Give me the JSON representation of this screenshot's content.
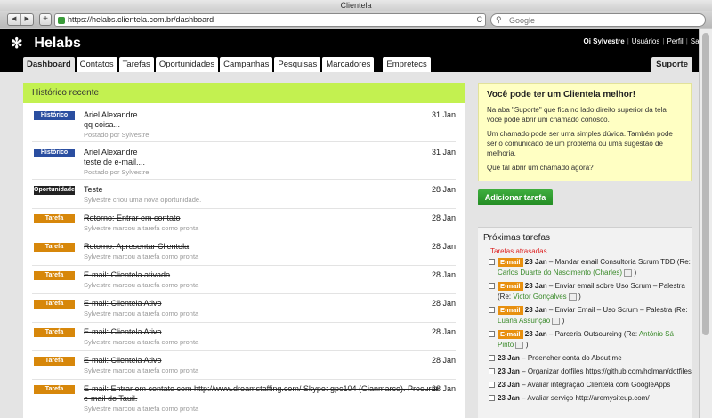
{
  "browser": {
    "window_title": "Clientela",
    "back": "◀",
    "forward": "▶",
    "new_tab": "+",
    "url": "https://helabs.clientela.com.br/dashboard",
    "reload": "C",
    "search_placeholder": "Google"
  },
  "app": {
    "name": "Helabs",
    "greeting": "Oi Sylvestre",
    "links": [
      "Usuários",
      "Perfil",
      "Sair"
    ]
  },
  "tabs": [
    "Dashboard",
    "Contatos",
    "Tarefas",
    "Oportunidades",
    "Campanhas",
    "Pesquisas",
    "Marcadores",
    "Empretecs"
  ],
  "support_tab": "Suporte",
  "history": {
    "title": "Histórico recente",
    "entries": [
      {
        "type": "Histórico",
        "title": "Ariel Alexandre",
        "body": "qq coisa...",
        "meta": "Postado por Sylvestre",
        "date": "31 Jan"
      },
      {
        "type": "Histórico",
        "title": "Ariel Alexandre",
        "body": "teste de e-mail....",
        "meta": "Postado por Sylvestre",
        "date": "31 Jan"
      },
      {
        "type": "Oportunidade",
        "title": "Teste",
        "meta": "Sylvestre criou uma nova oportunidade.",
        "date": "28 Jan"
      },
      {
        "type": "Tarefa",
        "title": "Retorno: Entrar em contato",
        "meta": "Sylvestre marcou a tarefa como pronta",
        "date": "28 Jan"
      },
      {
        "type": "Tarefa",
        "title": "Retorno: Apresentar Clientela",
        "meta": "Sylvestre marcou a tarefa como pronta",
        "date": "28 Jan"
      },
      {
        "type": "Tarefa",
        "title": "E-mail: Clientela ativado",
        "meta": "Sylvestre marcou a tarefa como pronta",
        "date": "28 Jan"
      },
      {
        "type": "Tarefa",
        "title": "E-mail: Clientela Ativo",
        "meta": "Sylvestre marcou a tarefa como pronta",
        "date": "28 Jan"
      },
      {
        "type": "Tarefa",
        "title": "E-mail: Clientela Ativo",
        "meta": "Sylvestre marcou a tarefa como pronta",
        "date": "28 Jan"
      },
      {
        "type": "Tarefa",
        "title": "E-mail: Clientela Ativo",
        "meta": "Sylvestre marcou a tarefa como pronta",
        "date": "28 Jan"
      },
      {
        "type": "Tarefa",
        "title": "E-mail: Entrar em contato com http://www.dreamstaffing.com/ Skype: gpc104 (Gianmarco). Procurar e-mail do Tauil.",
        "meta": "Sylvestre marcou a tarefa como pronta",
        "date": "28 Jan"
      }
    ]
  },
  "promo": {
    "title": "Você pode ter um Clientela melhor!",
    "p1": "Na aba \"Suporte\" que fica no lado direito superior da tela você pode abrir um chamado conosco.",
    "p2": "Um chamado pode ser uma simples dúvida. Também pode ser o comunicado de um problema ou uma sugestão de melhoria.",
    "p3": "Que tal abrir um chamado agora?"
  },
  "add_task_label": "Adicionar tarefa",
  "upcoming": {
    "title": "Próximas tarefas",
    "late_label": "Tarefas atrasadas",
    "tag": "E-mail",
    "items": [
      {
        "tag": true,
        "date": "23 Jan",
        "text": "– Mandar email Consultoria Scrum TDD (Re:",
        "ref": "Carlos Duarte do Nascimento (Charles)",
        "end": ")"
      },
      {
        "tag": true,
        "date": "23 Jan",
        "text": "– Enviar email sobre Uso Scrum – Palestra (Re:",
        "ref": "Victor Gonçalves",
        "end": ")"
      },
      {
        "tag": true,
        "date": "23 Jan",
        "text": "– Enviar Email – Uso Scrum – Palestra (Re:",
        "ref": "Luana Assunção",
        "end": ")"
      },
      {
        "tag": true,
        "date": "23 Jan",
        "text": "– Parceria Outsourcing (Re:",
        "ref": "António Sá Pinto",
        "end": ")"
      },
      {
        "tag": false,
        "date": "23 Jan",
        "text": "– Preencher conta do About.me",
        "ref": "",
        "end": ""
      },
      {
        "tag": false,
        "date": "23 Jan",
        "text": "– Organizar dotfiles https://github.com/holman/dotfiles",
        "ref": "",
        "end": ""
      },
      {
        "tag": false,
        "date": "23 Jan",
        "text": "– Avaliar integração Clientela com GoogleApps",
        "ref": "",
        "end": ""
      },
      {
        "tag": false,
        "date": "23 Jan",
        "text": "– Avaliar serviço http://aremysiteup.com/",
        "ref": "",
        "end": ""
      }
    ]
  }
}
